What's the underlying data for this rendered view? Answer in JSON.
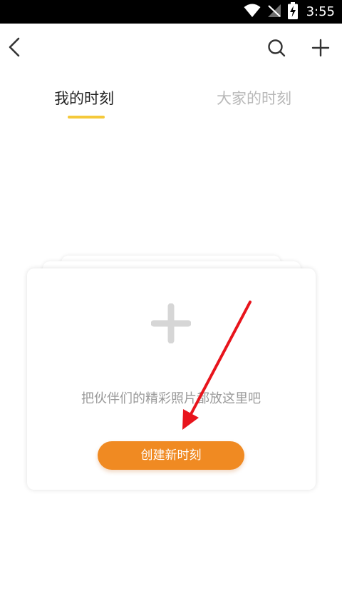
{
  "status_bar": {
    "time": "3:55",
    "icons": [
      "wifi-icon",
      "no-signal-icon",
      "battery-charging-icon"
    ]
  },
  "topbar": {
    "icons": [
      "back-icon",
      "search-icon",
      "plus-icon"
    ]
  },
  "tabs": [
    {
      "label": "我的时刻",
      "active": true
    },
    {
      "label": "大家的时刻",
      "active": false
    }
  ],
  "empty_state": {
    "icon": "plus-icon",
    "hint": "把伙伴们的精彩照片都放这里吧",
    "button_label": "创建新时刻"
  },
  "colors": {
    "tab_indicator": "#f5c93a",
    "primary_button": "#f08a22",
    "annotation_arrow": "#e8141c"
  }
}
